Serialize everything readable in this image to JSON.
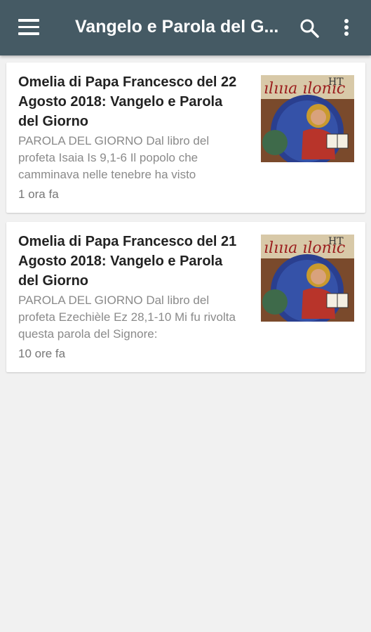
{
  "appbar": {
    "title": "Vangelo e Parola del G...",
    "menu_icon": "menu-icon",
    "search_icon": "search-icon",
    "more_icon": "more-vertical-icon",
    "color": "#455a64"
  },
  "articles": [
    {
      "title": "Omelia di Papa Francesco del 22 Agosto 2018: Vangelo e Parola del Giorno",
      "excerpt": "PAROLA DEL GIORNO Dal libro del profeta Isaia Is 9,1-6 Il popolo che camminava nelle tenebre ha visto",
      "time": "1 ora fa",
      "thumbnail": "illuminated-manuscript-christ-image"
    },
    {
      "title": "Omelia di Papa Francesco del 21 Agosto 2018: Vangelo e Parola del Giorno",
      "excerpt": "PAROLA DEL GIORNO Dal libro del profeta Ezechièle Ez 28,1-10 Mi fu rivolta questa parola del Signore:",
      "time": "10 ore fa",
      "thumbnail": "illuminated-manuscript-christ-image"
    }
  ]
}
